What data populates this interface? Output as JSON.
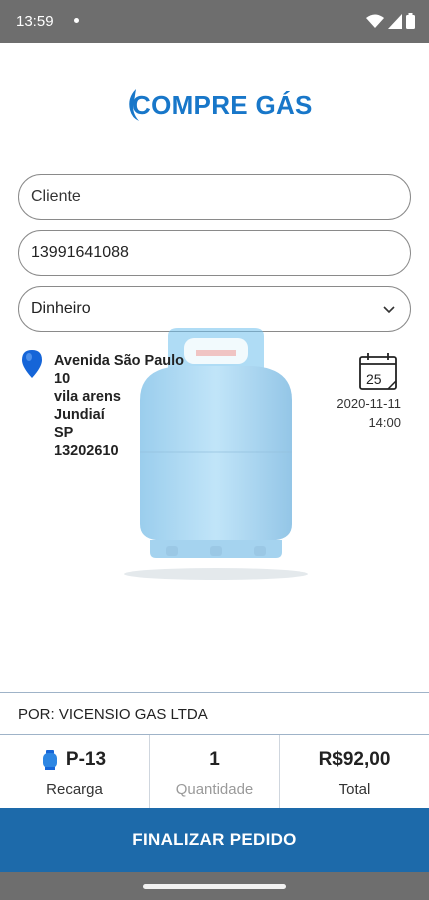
{
  "status_bar": {
    "time": "13:59",
    "icons": [
      "notification-dot",
      "wifi-icon",
      "signal-icon",
      "battery-icon"
    ]
  },
  "logo": {
    "text": "COMPRE GÁS",
    "color": "#1877c9"
  },
  "form": {
    "client_placeholder": "Cliente",
    "phone_value": "13991641088",
    "payment_selected": "Dinheiro"
  },
  "address": {
    "street": "Avenida São Paulo",
    "number": "10",
    "district": "vila arens",
    "city": "Jundiaí",
    "state": "SP",
    "zip": "13202610"
  },
  "schedule": {
    "calendar_day": "25",
    "date": "2020-11-11",
    "time": "14:00"
  },
  "seller": "POR: VICENSIO GAS LTDA",
  "summary": {
    "product": "P-13",
    "product_type": "Recarga",
    "quantity": "1",
    "quantity_label": "Quantidade",
    "total": "R$92,00",
    "total_label": "Total"
  },
  "actions": {
    "finalize_label": "FINALIZAR PEDIDO"
  },
  "colors": {
    "primary": "#1d6aaa",
    "accent": "#1877c9",
    "cylinder": "#5fb4e8"
  }
}
